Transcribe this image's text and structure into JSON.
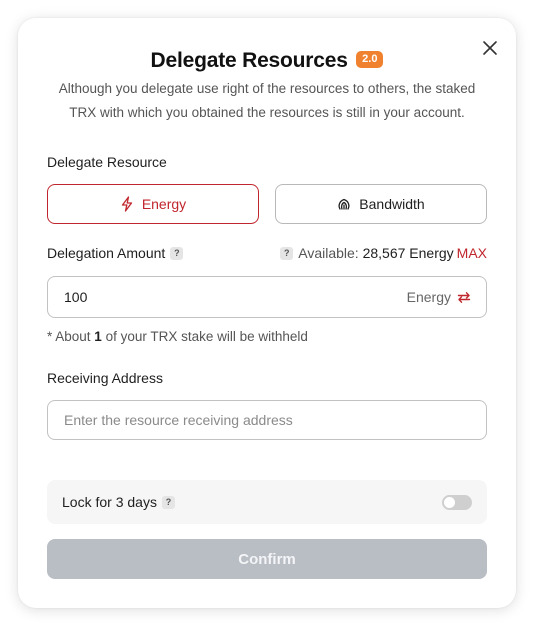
{
  "dialog": {
    "title": "Delegate Resources",
    "version_badge": "2.0",
    "subtitle": "Although you delegate use right of the resources to others, the staked TRX with which you obtained the resources is still in your account."
  },
  "resource": {
    "label": "Delegate Resource",
    "options": [
      {
        "label": "Energy",
        "icon": "lightning-icon",
        "selected": true
      },
      {
        "label": "Bandwidth",
        "icon": "bandwidth-icon",
        "selected": false
      }
    ],
    "accent_color": "#c0262d"
  },
  "amount": {
    "label": "Delegation Amount",
    "help": "?",
    "available_label": "Available:",
    "available_value": "28,567 Energy",
    "max_label": "MAX",
    "value": "100",
    "unit": "Energy"
  },
  "note": {
    "prefix": "* About ",
    "amount": "1",
    "suffix": " of your TRX stake will be withheld"
  },
  "receiving": {
    "label": "Receiving Address",
    "placeholder": "Enter the resource receiving address"
  },
  "lock": {
    "label": "Lock for 3 days",
    "enabled": false
  },
  "confirm": {
    "label": "Confirm",
    "disabled": true
  }
}
